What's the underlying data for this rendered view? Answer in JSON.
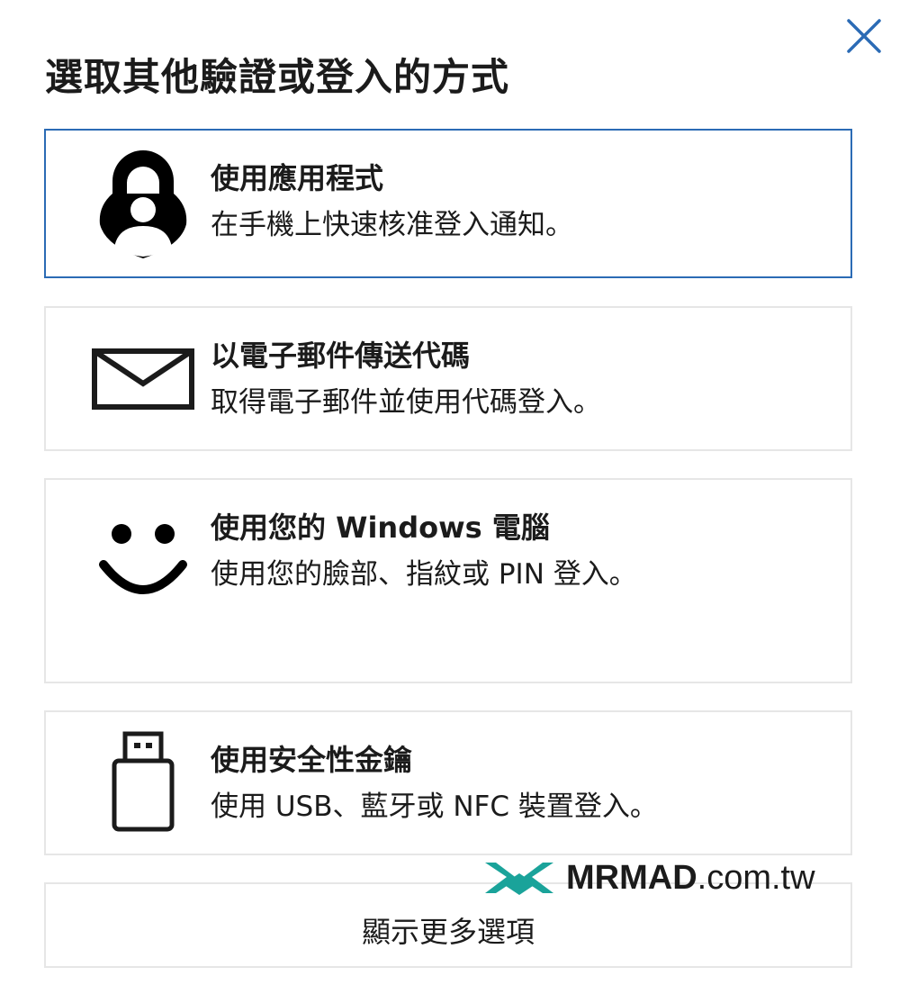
{
  "dialog": {
    "title": "選取其他驗證或登入的方式",
    "close_icon": "close-icon",
    "accent_color": "#2b6bb5"
  },
  "options": [
    {
      "icon": "authenticator-lock-icon",
      "title": "使用應用程式",
      "description": "在手機上快速核准登入通知。",
      "selected": true
    },
    {
      "icon": "envelope-icon",
      "title": "以電子郵件傳送代碼",
      "description": "取得電子郵件並使用代碼登入。",
      "selected": false
    },
    {
      "icon": "smiley-face-icon",
      "title": "使用您的 Windows 電腦",
      "description": "使用您的臉部、指紋或 PIN 登入。",
      "selected": false
    },
    {
      "icon": "usb-key-icon",
      "title": "使用安全性金鑰",
      "description": "使用 USB、藍牙或 NFC 裝置登入。",
      "selected": false
    }
  ],
  "more_options": {
    "label": "顯示更多選項"
  },
  "watermark": {
    "brand": "MRMAD",
    "domain": ".com.tw",
    "logo_color": "#1aa39a"
  }
}
